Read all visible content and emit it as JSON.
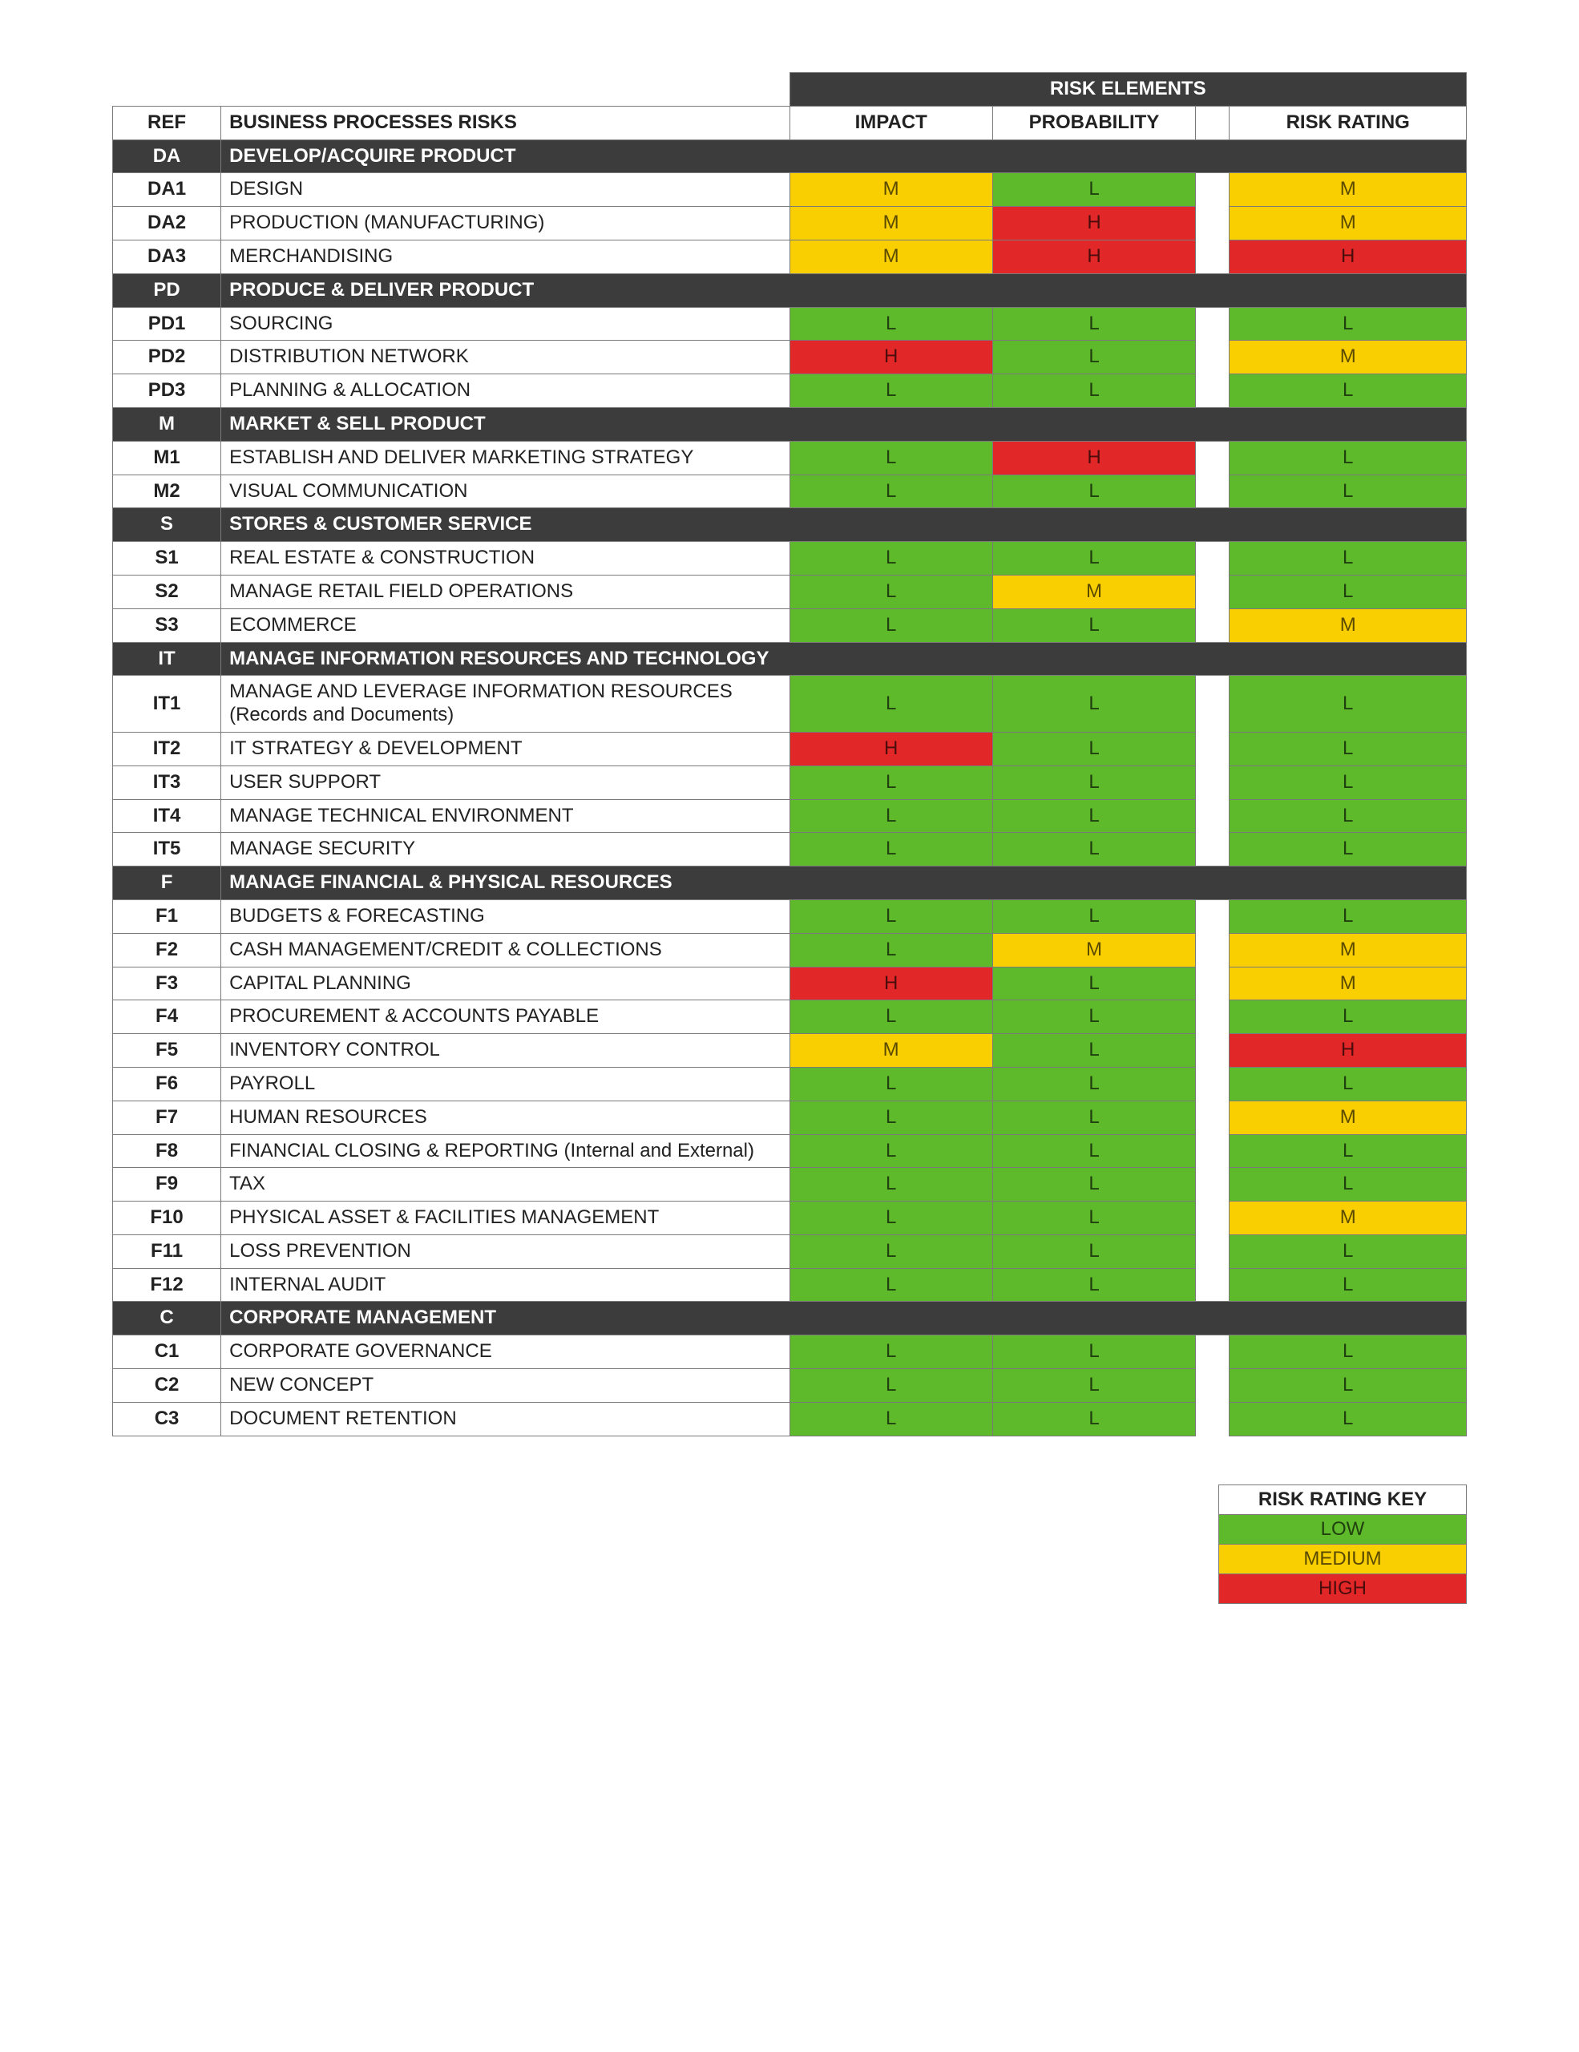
{
  "header": {
    "riskElements": "RISK ELEMENTS",
    "ref": "REF",
    "desc": "BUSINESS PROCESSES RISKS",
    "impact": "IMPACT",
    "probability": "PROBABILITY",
    "rating": "RISK RATING"
  },
  "legend": {
    "title": "RISK RATING KEY",
    "low": "LOW",
    "medium": "MEDIUM",
    "high": "HIGH"
  },
  "colors": {
    "low": "#5fba2b",
    "medium": "#f9cf01",
    "high": "#e12727",
    "section": "#3c3c3c"
  },
  "sections": [
    {
      "ref": "DA",
      "title": "DEVELOP/ACQUIRE PRODUCT",
      "rows": [
        {
          "ref": "DA1",
          "desc": "DESIGN",
          "impact": "M",
          "probability": "L",
          "rating": "M"
        },
        {
          "ref": "DA2",
          "desc": "PRODUCTION (MANUFACTURING)",
          "impact": "M",
          "probability": "H",
          "rating": "M"
        },
        {
          "ref": "DA3",
          "desc": "MERCHANDISING",
          "impact": "M",
          "probability": "H",
          "rating": "H"
        }
      ]
    },
    {
      "ref": "PD",
      "title": "PRODUCE & DELIVER PRODUCT",
      "rows": [
        {
          "ref": "PD1",
          "desc": "SOURCING",
          "impact": "L",
          "probability": "L",
          "rating": "L"
        },
        {
          "ref": "PD2",
          "desc": "DISTRIBUTION NETWORK",
          "impact": "H",
          "probability": "L",
          "rating": "M"
        },
        {
          "ref": "PD3",
          "desc": "PLANNING & ALLOCATION",
          "impact": "L",
          "probability": "L",
          "rating": "L"
        }
      ]
    },
    {
      "ref": "M",
      "title": "MARKET & SELL PRODUCT",
      "rows": [
        {
          "ref": "M1",
          "desc": "ESTABLISH AND DELIVER MARKETING STRATEGY",
          "impact": "L",
          "probability": "H",
          "rating": "L"
        },
        {
          "ref": "M2",
          "desc": "VISUAL COMMUNICATION",
          "impact": "L",
          "probability": "L",
          "rating": "L"
        }
      ]
    },
    {
      "ref": "S",
      "title": "STORES & CUSTOMER SERVICE",
      "rows": [
        {
          "ref": "S1",
          "desc": "REAL ESTATE & CONSTRUCTION",
          "impact": "L",
          "probability": "L",
          "rating": "L"
        },
        {
          "ref": "S2",
          "desc": "MANAGE RETAIL FIELD OPERATIONS",
          "impact": "L",
          "probability": "M",
          "rating": "L"
        },
        {
          "ref": "S3",
          "desc": "ECOMMERCE",
          "impact": "L",
          "probability": "L",
          "rating": "M"
        }
      ]
    },
    {
      "ref": "IT",
      "title": "MANAGE INFORMATION RESOURCES AND TECHNOLOGY",
      "rows": [
        {
          "ref": "IT1",
          "desc": "MANAGE AND LEVERAGE INFORMATION RESOURCES (Records and Documents)",
          "impact": "L",
          "probability": "L",
          "rating": "L"
        },
        {
          "ref": "IT2",
          "desc": "IT STRATEGY & DEVELOPMENT",
          "impact": "H",
          "probability": "L",
          "rating": "L"
        },
        {
          "ref": "IT3",
          "desc": "USER SUPPORT",
          "impact": "L",
          "probability": "L",
          "rating": "L"
        },
        {
          "ref": "IT4",
          "desc": "MANAGE TECHNICAL ENVIRONMENT",
          "impact": "L",
          "probability": "L",
          "rating": "L"
        },
        {
          "ref": "IT5",
          "desc": "MANAGE SECURITY",
          "impact": "L",
          "probability": "L",
          "rating": "L"
        }
      ]
    },
    {
      "ref": "F",
      "title": "MANAGE FINANCIAL & PHYSICAL RESOURCES",
      "rows": [
        {
          "ref": "F1",
          "desc": "BUDGETS & FORECASTING",
          "impact": "L",
          "probability": "L",
          "rating": "L"
        },
        {
          "ref": "F2",
          "desc": "CASH MANAGEMENT/CREDIT & COLLECTIONS",
          "impact": "L",
          "probability": "M",
          "rating": "M"
        },
        {
          "ref": "F3",
          "desc": "CAPITAL PLANNING",
          "impact": "H",
          "probability": "L",
          "rating": "M"
        },
        {
          "ref": "F4",
          "desc": "PROCUREMENT & ACCOUNTS PAYABLE",
          "impact": "L",
          "probability": "L",
          "rating": "L"
        },
        {
          "ref": "F5",
          "desc": "INVENTORY CONTROL",
          "impact": "M",
          "probability": "L",
          "rating": "H"
        },
        {
          "ref": "F6",
          "desc": "PAYROLL",
          "impact": "L",
          "probability": "L",
          "rating": "L"
        },
        {
          "ref": "F7",
          "desc": "HUMAN RESOURCES",
          "impact": "L",
          "probability": "L",
          "rating": "M"
        },
        {
          "ref": "F8",
          "desc": "FINANCIAL CLOSING & REPORTING (Internal and External)",
          "impact": "L",
          "probability": "L",
          "rating": "L"
        },
        {
          "ref": "F9",
          "desc": "TAX",
          "impact": "L",
          "probability": "L",
          "rating": "L"
        },
        {
          "ref": "F10",
          "desc": "PHYSICAL ASSET & FACILITIES MANAGEMENT",
          "impact": "L",
          "probability": "L",
          "rating": "M"
        },
        {
          "ref": "F11",
          "desc": "LOSS PREVENTION",
          "impact": "L",
          "probability": "L",
          "rating": "L"
        },
        {
          "ref": "F12",
          "desc": "INTERNAL AUDIT",
          "impact": "L",
          "probability": "L",
          "rating": "L"
        }
      ]
    },
    {
      "ref": "C",
      "title": "CORPORATE MANAGEMENT",
      "rows": [
        {
          "ref": "C1",
          "desc": "CORPORATE GOVERNANCE",
          "impact": "L",
          "probability": "L",
          "rating": "L"
        },
        {
          "ref": "C2",
          "desc": "NEW CONCEPT",
          "impact": "L",
          "probability": "L",
          "rating": "L"
        },
        {
          "ref": "C3",
          "desc": "DOCUMENT RETENTION",
          "impact": "L",
          "probability": "L",
          "rating": "L"
        }
      ]
    }
  ]
}
